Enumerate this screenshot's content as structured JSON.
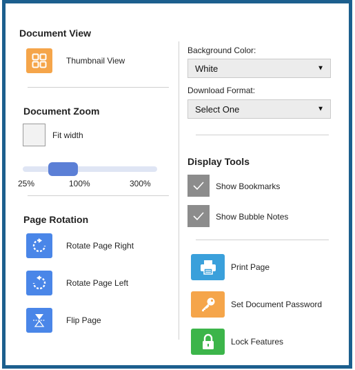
{
  "left": {
    "document_view": {
      "title": "Document View",
      "thumbnail_label": "Thumbnail View"
    },
    "document_zoom": {
      "title": "Document Zoom",
      "fit_width_label": "Fit width",
      "zoom_min_label": "25%",
      "zoom_current_label": "100%",
      "zoom_max_label": "300%",
      "zoom_level_fraction": 0.27
    },
    "page_rotation": {
      "title": "Page Rotation",
      "rotate_right_label": "Rotate Page Right",
      "rotate_left_label": "Rotate Page Left",
      "flip_label": "Flip Page"
    }
  },
  "right": {
    "background_color": {
      "label": "Background Color:",
      "selected": "White"
    },
    "download_format": {
      "label": "Download Format:",
      "selected": "Select One"
    },
    "display_tools": {
      "title": "Display Tools",
      "show_bookmarks_label": "Show Bookmarks",
      "show_bubble_notes_label": "Show Bubble Notes"
    },
    "actions": {
      "print_label": "Print Page",
      "password_label": "Set Document Password",
      "lock_label": "Lock Features"
    }
  },
  "colors": {
    "frame": "#1c5f8e",
    "thumbnail_icon": "#f5a54a",
    "rotation_icons": "#4a86e8",
    "print_icon": "#3aa0db",
    "password_icon": "#f5a54a",
    "lock_icon": "#3cb54a",
    "checkbox_checked": "#8c8c8c",
    "slider_thumb": "#5b7fd6"
  },
  "icons": {
    "thumbnail": "grid-icon",
    "rotate_right": "rotate-right-icon",
    "rotate_left": "rotate-left-icon",
    "flip": "flip-icon",
    "print": "printer-icon",
    "password": "key-icon",
    "lock": "lock-icon",
    "check": "checkmark-icon"
  }
}
